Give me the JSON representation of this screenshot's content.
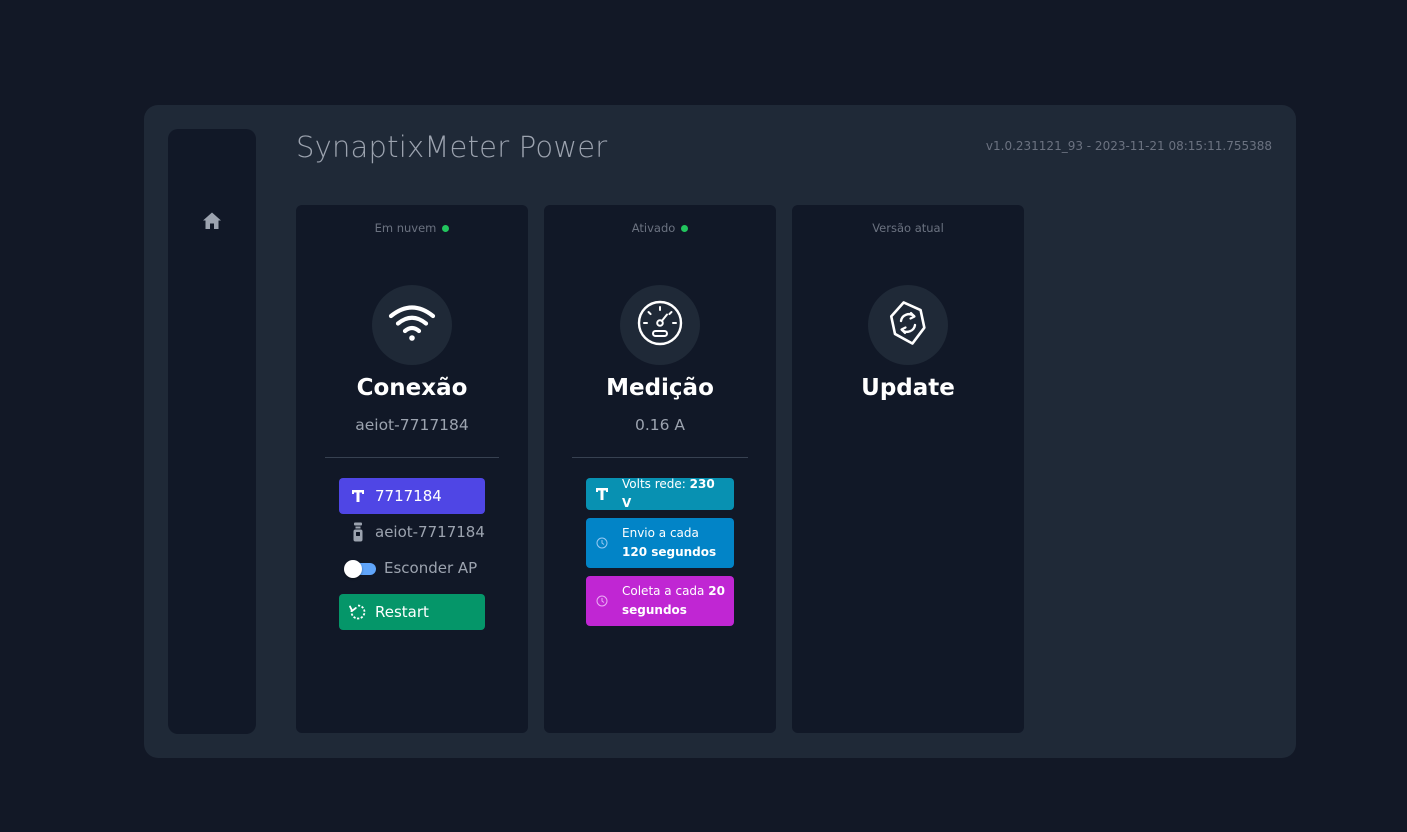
{
  "app": {
    "title": "SynaptixMeter Power",
    "version": "v1.0.231121_93 - 2023-11-21 08:15:11.755388"
  },
  "sidebar": {
    "items": [
      {
        "icon": "home-icon"
      }
    ]
  },
  "cards": {
    "connection": {
      "status": "Em nuvem",
      "status_color": "#22c55e",
      "icon": "wifi-icon",
      "title": "Conexão",
      "subtitle": "aeiot-7717184",
      "id_button": "7717184",
      "ssid": "aeiot-7717184",
      "hide_ap_label": "Esconder AP",
      "hide_ap_enabled": false,
      "restart_label": "Restart"
    },
    "measurement": {
      "status": "Ativado",
      "status_color": "#22c55e",
      "icon": "gauge-icon",
      "title": "Medição",
      "subtitle": "0.16 A",
      "volts": {
        "label": "Volts rede: ",
        "value": "230 V"
      },
      "envio": {
        "label": "Envio a cada ",
        "value": "120 segundos"
      },
      "coleta": {
        "label": "Coleta a cada ",
        "value": "20 segundos"
      }
    },
    "update": {
      "status": "Versão atual",
      "icon": "sync-icon",
      "title": "Update"
    }
  },
  "colors": {
    "background": "#121826",
    "panel": "#1f2937",
    "card": "#111827",
    "indigo": "#4f46e5",
    "green": "#059669",
    "cyan": "#0891b2",
    "sky": "#0284c7",
    "fuchsia": "#c026d3"
  }
}
